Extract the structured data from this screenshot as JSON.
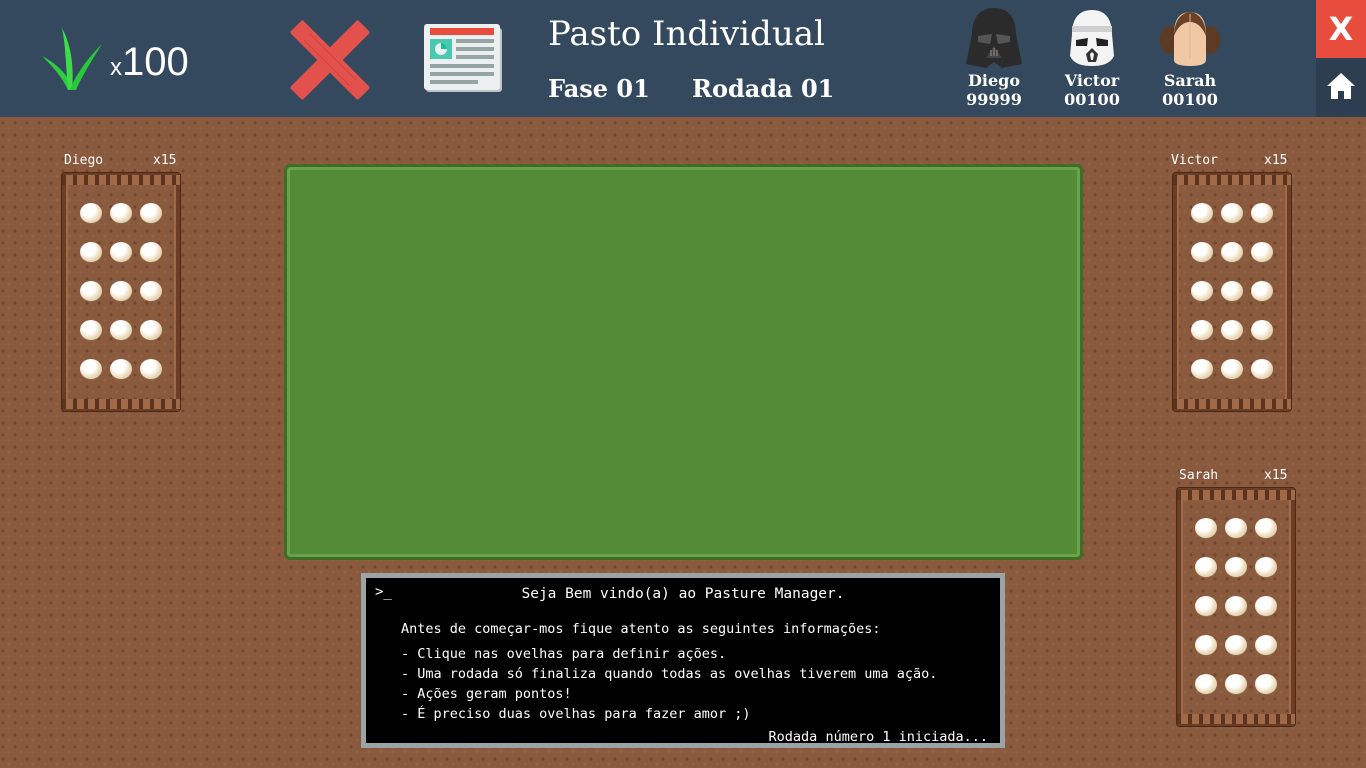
{
  "header": {
    "grass_prefix": "x",
    "grass_count": "100",
    "title": "Pasto Individual",
    "fase": "Fase 01",
    "rodada": "Rodada 01",
    "close_label": "X",
    "players": [
      {
        "name": "Diego",
        "score": "99999",
        "avatar": "darth-vader-icon"
      },
      {
        "name": "Victor",
        "score": "00100",
        "avatar": "stormtrooper-icon"
      },
      {
        "name": "Sarah",
        "score": "00100",
        "avatar": "princess-leia-icon"
      }
    ]
  },
  "pens": [
    {
      "name": "Diego",
      "count": "x15"
    },
    {
      "name": "Victor",
      "count": "x15"
    },
    {
      "name": "Sarah",
      "count": "x15"
    }
  ],
  "console": {
    "prompt": ">_",
    "welcome": "Seja Bem vindo(a) ao Pasture Manager.",
    "intro": "Antes de começar-mos fique atento as seguintes informações:",
    "lines": [
      "- Clique nas ovelhas para definir ações.",
      "- Uma rodada só finaliza quando todas as ovelhas tiverem uma ação.",
      "- Ações geram pontos!",
      "- É preciso duas ovelhas para fazer amor ;)"
    ],
    "status": "Rodada número 1 iniciada..."
  },
  "colors": {
    "header_bg": "#34495e",
    "close_bg": "#e74c3c",
    "home_bg": "#2c3e50",
    "pasture": "#548b37",
    "ground": "#8a5a3f"
  }
}
